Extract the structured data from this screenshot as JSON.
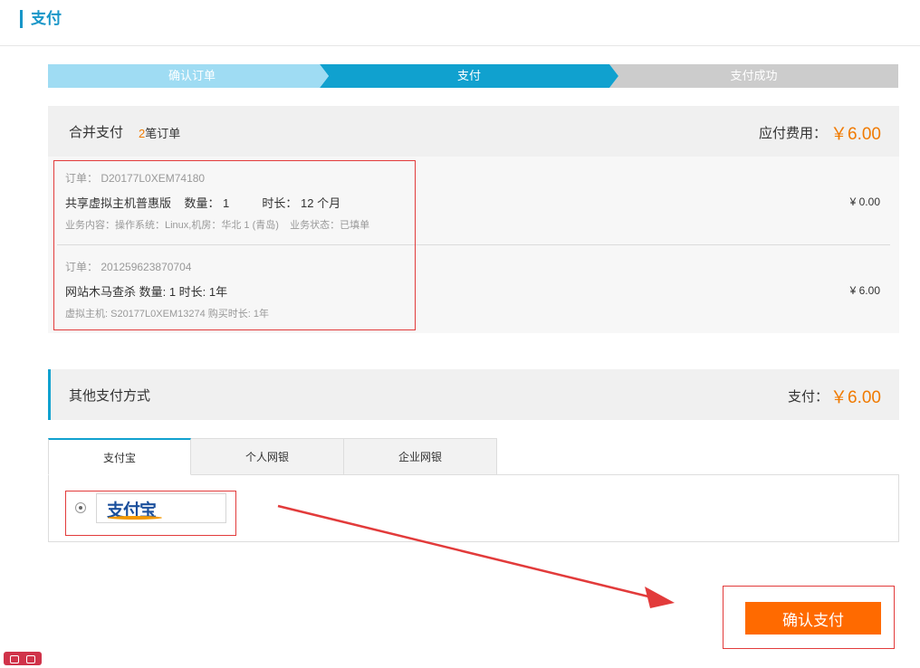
{
  "page": {
    "title": "支付"
  },
  "steps": [
    {
      "label": "确认订单",
      "state": "done"
    },
    {
      "label": "支付",
      "state": "current"
    },
    {
      "label": "支付成功",
      "state": "pending"
    }
  ],
  "merge": {
    "title": "合并支付",
    "count": "2",
    "count_suffix": "笔订单",
    "amount_label": "应付费用：",
    "amount": "￥6.00"
  },
  "orders": [
    {
      "no": "订单： D20177L0XEM74180",
      "main": "共享虚拟主机普惠版    数量： 1          时长： 12 个月",
      "detail": "业务内容：操作系统：Linux,机房：华北 1 (青岛)    业务状态：已填单",
      "price": "¥ 0.00"
    },
    {
      "no": "订单： 201259623870704",
      "main": "网站木马查杀 数量: 1 时长: 1年",
      "detail": "虚拟主机: S20177L0XEM13274 购买时长: 1年",
      "price": "¥ 6.00"
    }
  ],
  "other_payment": {
    "title": "其他支付方式",
    "pay_label": "支付：",
    "amount": "￥6.00"
  },
  "tabs": [
    {
      "label": "支付宝",
      "active": true
    },
    {
      "label": "个人网银",
      "active": false
    },
    {
      "label": "企业网银",
      "active": false
    }
  ],
  "alipay": {
    "logo_text": "支付宝",
    "selected": true
  },
  "confirm": {
    "label": "确认支付"
  },
  "colors": {
    "accent": "#10a1cf",
    "price": "#f07a00",
    "confirm_button": "#ff6a00",
    "annotation": "#e23b3b"
  }
}
